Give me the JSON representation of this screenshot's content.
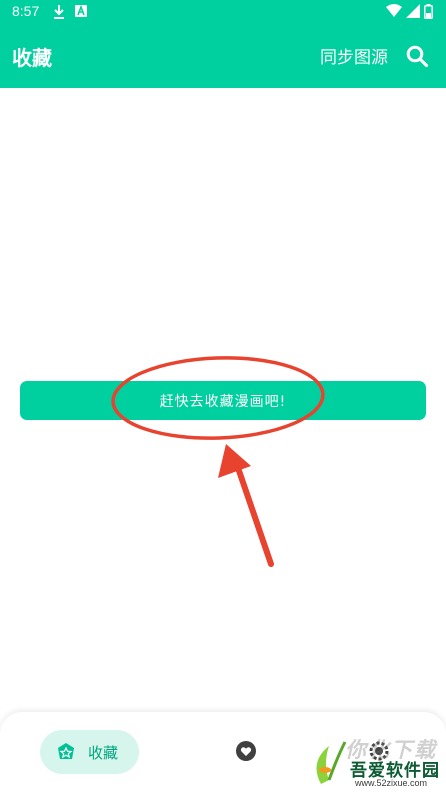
{
  "status_bar": {
    "time": "8:57",
    "left_icons": [
      "download-icon",
      "app-notification-icon"
    ],
    "right_icons": [
      "wifi-icon",
      "signal-icon",
      "battery-icon"
    ]
  },
  "appbar": {
    "title": "收藏",
    "sync_label": "同步图源",
    "search_icon": "search-icon"
  },
  "main": {
    "cta_label": "赶快去收藏漫画吧!"
  },
  "bottom_nav": {
    "items": [
      {
        "label": "收藏",
        "icon": "favorite-tag-icon",
        "active": true
      },
      {
        "label": "",
        "icon": "heart-icon",
        "active": false
      },
      {
        "label": "",
        "icon": "settings-icon",
        "active": false
      }
    ]
  },
  "watermark": {
    "line1": "你化下载",
    "line2": "吾爱软件园",
    "line3": "www.52zixue.com"
  },
  "colors": {
    "primary": "#00cf9f",
    "active_pill": "#d6f5ec",
    "annotation": "#e8432f"
  }
}
